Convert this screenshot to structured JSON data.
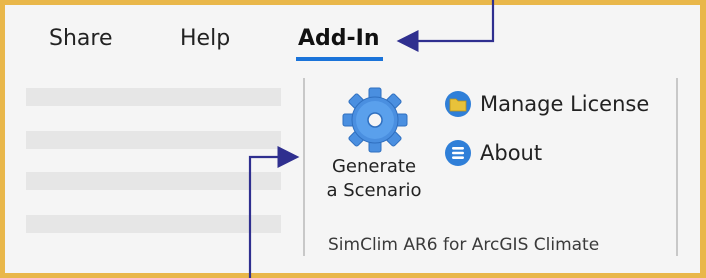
{
  "ribbon": {
    "tabs": [
      {
        "label": "Share",
        "active": false
      },
      {
        "label": "Help",
        "active": false
      },
      {
        "label": "Add-In",
        "active": true
      }
    ],
    "group": {
      "name": "SimClim AR6 for ArcGIS Climate",
      "generate_button": {
        "label_line1": "Generate",
        "label_line2": "a Scenario",
        "icon": "gear-icon"
      },
      "manage_license_button": {
        "label": "Manage License",
        "icon": "license-icon"
      },
      "about_button": {
        "label": "About",
        "icon": "info-list-icon"
      }
    }
  },
  "colors": {
    "border": "#e9b74a",
    "background": "#f5f5f5",
    "accent_underline": "#1a73d9",
    "callout_arrow": "#2f2f8f",
    "gear": "#4a8fe0",
    "icon_circle": "#2f7fd8",
    "license_folder": "#e8c23a"
  }
}
